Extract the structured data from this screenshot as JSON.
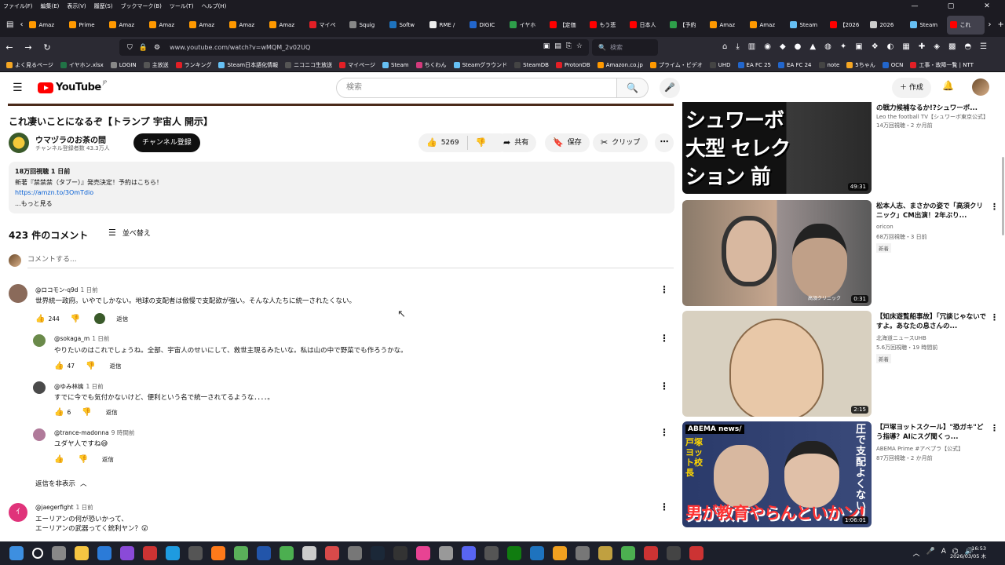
{
  "menubar": {
    "items": [
      "ファイル(F)",
      "編集(E)",
      "表示(V)",
      "履歴(S)",
      "ブックマーク(B)",
      "ツール(T)",
      "ヘルプ(H)"
    ]
  },
  "tabs": [
    {
      "label": "Amaz",
      "color": "#ff9900"
    },
    {
      "label": "Prime",
      "color": "#ff9900"
    },
    {
      "label": "Amaz",
      "color": "#ff9900"
    },
    {
      "label": "Amaz",
      "color": "#ff9900"
    },
    {
      "label": "Amaz",
      "color": "#ff9900"
    },
    {
      "label": "Amaz",
      "color": "#ff9900"
    },
    {
      "label": "Amaz",
      "color": "#ff9900"
    },
    {
      "label": "マイペ",
      "color": "#e31f26"
    },
    {
      "label": "Squig",
      "color": "#888888"
    },
    {
      "label": "Softw",
      "color": "#1e73be"
    },
    {
      "label": "RME /",
      "color": "#eeeeee"
    },
    {
      "label": "DIGIC",
      "color": "#2266cc"
    },
    {
      "label": "イヤホ",
      "color": "#2e9f4a"
    },
    {
      "label": "【定価",
      "color": "#ff0000"
    },
    {
      "label": "もう悲",
      "color": "#ff0000"
    },
    {
      "label": "日本人",
      "color": "#ff0000"
    },
    {
      "label": "【予約",
      "color": "#2e9f4a"
    },
    {
      "label": "Amaz",
      "color": "#ff9900"
    },
    {
      "label": "Amaz",
      "color": "#ff9900"
    },
    {
      "label": "Steam",
      "color": "#66c0f4"
    },
    {
      "label": "【2026",
      "color": "#ff0000"
    },
    {
      "label": "2026",
      "color": "#cccccc"
    },
    {
      "label": "Steam",
      "color": "#66c0f4"
    },
    {
      "label": "これ",
      "color": "#ff0000",
      "active": true
    }
  ],
  "navbar": {
    "url": "www.youtube.com/watch?v=wMQM_2v02UQ",
    "search_placeholder": "検索"
  },
  "bookmarks": [
    {
      "label": "よく見るページ",
      "color": "#f5a623"
    },
    {
      "label": "イヤホン.xlsx",
      "color": "#217346"
    },
    {
      "label": "LOGIN",
      "color": "#888888"
    },
    {
      "label": "主放送",
      "color": "#555555"
    },
    {
      "label": "ランキング",
      "color": "#e31f26"
    },
    {
      "label": "Steam日本語化情報",
      "color": "#66c0f4"
    },
    {
      "label": "ニコニコ生放送",
      "color": "#555555"
    },
    {
      "label": "マイページ",
      "color": "#e31f26"
    },
    {
      "label": "Steam",
      "color": "#66c0f4"
    },
    {
      "label": "ちくわん",
      "color": "#d33a7c"
    },
    {
      "label": "Steamグラウンド",
      "color": "#66c0f4"
    },
    {
      "label": "SteamDB",
      "color": "#444444"
    },
    {
      "label": "ProtonDB",
      "color": "#e31f26"
    },
    {
      "label": "Amazon.co.jp",
      "color": "#ff9900"
    },
    {
      "label": "プライム・ビデオ",
      "color": "#ff9900"
    },
    {
      "label": "UHD",
      "color": "#444444"
    },
    {
      "label": "EA FC 25",
      "color": "#2266cc"
    },
    {
      "label": "EA FC 24",
      "color": "#2266cc"
    },
    {
      "label": "note",
      "color": "#444444"
    },
    {
      "label": "5ちゃん",
      "color": "#f5a623"
    },
    {
      "label": "OCN",
      "color": "#2266cc"
    },
    {
      "label": "工事・故障一覧 | NTT",
      "color": "#e31f26"
    }
  ],
  "header": {
    "logo_text": "YouTube",
    "logo_region": "JP",
    "search_placeholder": "検索",
    "create_label": "作成"
  },
  "video": {
    "title": "これ凄いことになるぞ【トランプ 宇宙人 開示】",
    "channel_name": "ウマヅラのお茶の間",
    "subscribers": "チャンネル登録者数 43.3万人",
    "subscribe_label": "チャンネル登録",
    "likes": "5269",
    "share_label": "共有",
    "save_label": "保存",
    "clip_label": "クリップ",
    "description": {
      "stats": "18万回視聴 1 日前",
      "line1": "新著『禁禁禁（タブー）』発売決定！予約はこちら！",
      "link": "https://amzn.to/3OmTdio",
      "more": "...もっと見る"
    }
  },
  "comments_section": {
    "count_label": "423 件のコメント",
    "sort_label": "並べ替え",
    "add_placeholder": "コメントする...",
    "hide_replies_label": "返信を非表示"
  },
  "comments": [
    {
      "author": "@ロコモン-q9d",
      "time": "1 日前",
      "text": "世界統一政府。いやでしかない。地球の支配者は傲慢で支配欲が強い。そんな人たちに統一されたくない。",
      "likes": "244",
      "reply_label": "返信",
      "avatar_color": "#8a6a5a"
    },
    {
      "author": "@sokaga_m",
      "time": "1 日前",
      "text": "やりたいのはこれでしょうね。全部、宇宙人のせいにして、救世主現るみたいな。私は山の中で野菜でも作ろうかな。",
      "likes": "47",
      "reply_label": "返信",
      "avatar_color": "#6a8a4a"
    },
    {
      "author": "@ゆみ林檎",
      "time": "1 日前",
      "text": "すでに今でも気付かないけど、便利という名で統一されてるような．．．．。",
      "likes": "6",
      "reply_label": "返信",
      "avatar_color": "#4a4a4a"
    },
    {
      "author": "@trance-madonna",
      "time": "9 時間前",
      "text": "ユダヤ人ですね😅",
      "likes": "",
      "reply_label": "返信",
      "avatar_color": "#b07a9a"
    },
    {
      "author": "@jaegerfight",
      "time": "1 日前",
      "text": "エーリアンの何が恐いかって、",
      "text2": "エーリアンの武器ってく銃利ヤン？😮",
      "likes": "",
      "reply_label": "返信",
      "avatar_color": "#e0337a",
      "avatar_letter": "ｲ"
    }
  ],
  "sidebar": [
    {
      "title": "の戦力候補なるか!?シュワーボ...",
      "channel": "Leo the football TV【シュワーボ東京公式】",
      "meta": "14万回視聴・2 か月前",
      "duration": "49:31",
      "thumb_text": "シュワーボ 大型 セレクション 前",
      "thumb_bg": "#1a1a1a"
    },
    {
      "title": "松本人志、まさかの姿で「高須クリニック」CM出演！2年ぶり...",
      "channel": "oricon",
      "meta": "68万回視聴・3 日前",
      "badge": "新着",
      "duration": "0:31",
      "thumb_text": "高須クリニック",
      "thumb_bg": "#6a6a6a"
    },
    {
      "title": "【知床遊覧船事故】「冗談じゃないですよ。あなたの息さんの...",
      "channel": "北海道ニュースUHB",
      "meta": "5.6万回視聴・19 時間前",
      "badge": "新着",
      "duration": "2:15",
      "thumb_text": "",
      "thumb_bg": "#d8d0c0"
    },
    {
      "title": "【戸塚ヨットスクール】\"恐ガキ\"どう指導？AIにスグ聞くっ...",
      "channel": "ABEMA Prime #アベプラ【公式】",
      "meta": "87万回視聴・2 か月前",
      "duration": "1:06:01",
      "thumb_text": "男が教育やらんといかン!",
      "thumb_sub": "圧で支配よくない",
      "thumb_sub2": "戸塚ヨット校長",
      "thumb_logo": "ABEMA news/",
      "thumb_bg": "#2a3a5a"
    }
  ],
  "taskbar": {
    "time": "16:53",
    "date": "2026/03/05 木",
    "icons": [
      "windows",
      "search",
      "settings",
      "explorer",
      "app",
      "calculator",
      "app",
      "edge",
      "app",
      "firefox",
      "app",
      "app",
      "chrome",
      "app",
      "app",
      "app",
      "steam",
      "app",
      "app",
      "app",
      "discord",
      "app",
      "xbox",
      "app",
      "app",
      "app",
      "app",
      "app",
      "app",
      "app",
      "app"
    ]
  }
}
